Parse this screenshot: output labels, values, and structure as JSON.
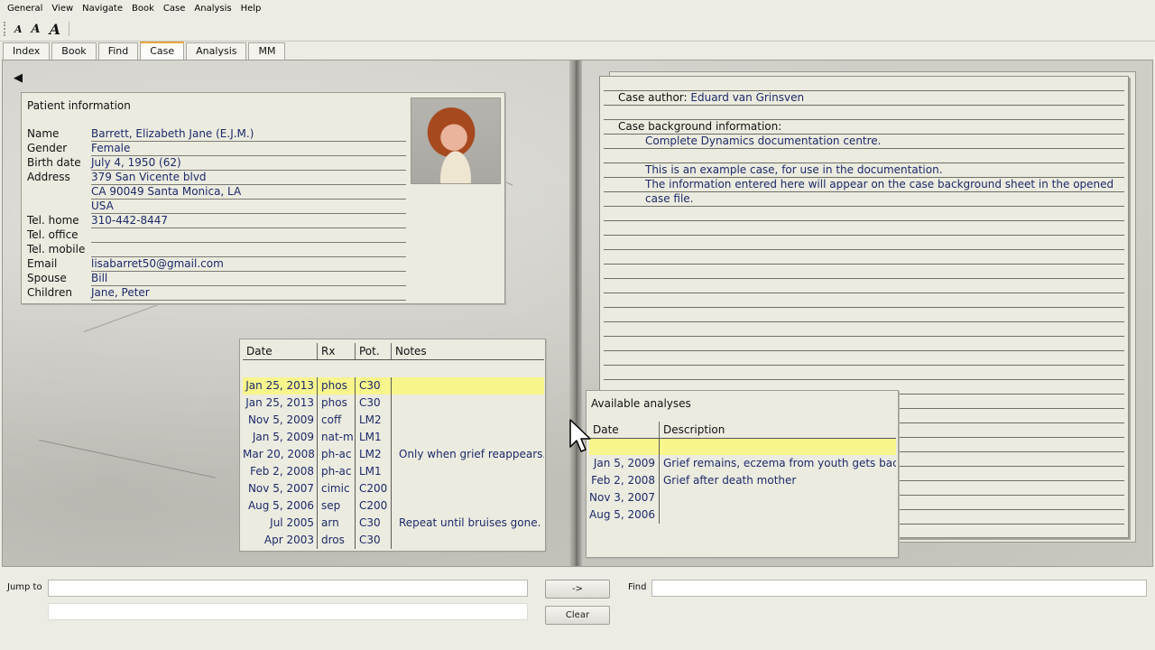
{
  "menu": [
    "General",
    "View",
    "Navigate",
    "Book",
    "Case",
    "Analysis",
    "Help"
  ],
  "font_buttons": [
    "A",
    "A",
    "A"
  ],
  "tabs": [
    "Index",
    "Book",
    "Find",
    "Case",
    "Analysis",
    "MM"
  ],
  "active_tab": "Case",
  "back_arrow": "◀",
  "patient": {
    "title": "Patient information",
    "fields": [
      {
        "label": "Name",
        "value": "Barrett, Elizabeth Jane (E.J.M.)"
      },
      {
        "label": "Gender",
        "value": "Female"
      },
      {
        "label": "Birth date",
        "value": "July 4, 1950 (62)"
      },
      {
        "label": "Address",
        "value": "379 San Vicente blvd"
      },
      {
        "label": "",
        "value": "CA 90049  Santa Monica, LA"
      },
      {
        "label": "",
        "value": "USA"
      },
      {
        "label": "Tel. home",
        "value": "310-442-8447"
      },
      {
        "label": "Tel. office",
        "value": ""
      },
      {
        "label": "Tel. mobile",
        "value": ""
      },
      {
        "label": "Email",
        "value": "lisabarret50@gmail.com"
      },
      {
        "label": "Spouse",
        "value": "Bill"
      },
      {
        "label": "Children",
        "value": "Jane, Peter"
      }
    ]
  },
  "remedies": {
    "headers": {
      "date": "Date",
      "rx": "Rx",
      "pot": "Pot.",
      "notes": "Notes"
    },
    "rows": [
      {
        "date": "Jan 25, 2013",
        "rx": "phos",
        "pot": "C30",
        "notes": ""
      },
      {
        "date": "Jan 25, 2013",
        "rx": "phos",
        "pot": "C30",
        "notes": ""
      },
      {
        "date": "Nov 5, 2009",
        "rx": "coff",
        "pot": "LM2",
        "notes": ""
      },
      {
        "date": "Jan 5, 2009",
        "rx": "nat-m",
        "pot": "LM1",
        "notes": ""
      },
      {
        "date": "Mar 20, 2008",
        "rx": "ph-ac",
        "pot": "LM2",
        "notes": "Only when grief reappears."
      },
      {
        "date": "Feb 2, 2008",
        "rx": "ph-ac",
        "pot": "LM1",
        "notes": ""
      },
      {
        "date": "Nov 5, 2007",
        "rx": "cimic",
        "pot": "C200",
        "notes": ""
      },
      {
        "date": "Aug 5, 2006",
        "rx": "sep",
        "pot": "C200",
        "notes": ""
      },
      {
        "date": "Jul 2005",
        "rx": "arn",
        "pot": "C30",
        "notes": "Repeat until bruises gone."
      },
      {
        "date": "Apr 2003",
        "rx": "dros",
        "pot": "C30",
        "notes": ""
      }
    ]
  },
  "case_info": {
    "author_label": "Case author:",
    "author": "Eduard van Grinsven",
    "background_label": "Case background information:",
    "lines": [
      "Complete Dynamics documentation centre.",
      "",
      "This is an example case, for use in the documentation.",
      "The information entered here will appear on the case background sheet in the opened",
      "case file."
    ]
  },
  "analyses": {
    "title": "Available analyses",
    "headers": {
      "date": "Date",
      "description": "Description"
    },
    "rows": [
      {
        "date": "",
        "description": ""
      },
      {
        "date": "Jan 5, 2009",
        "description": "Grief remains, eczema from youth gets back"
      },
      {
        "date": "Feb 2, 2008",
        "description": "Grief after death mother"
      },
      {
        "date": "Nov 3, 2007",
        "description": ""
      },
      {
        "date": "Aug 5, 2006",
        "description": ""
      }
    ]
  },
  "bottom": {
    "jump_label": "Jump to",
    "jump_value": "",
    "jump_value2": "",
    "go_button": "->",
    "clear_button": "Clear",
    "find_label": "Find",
    "find_value": ""
  }
}
